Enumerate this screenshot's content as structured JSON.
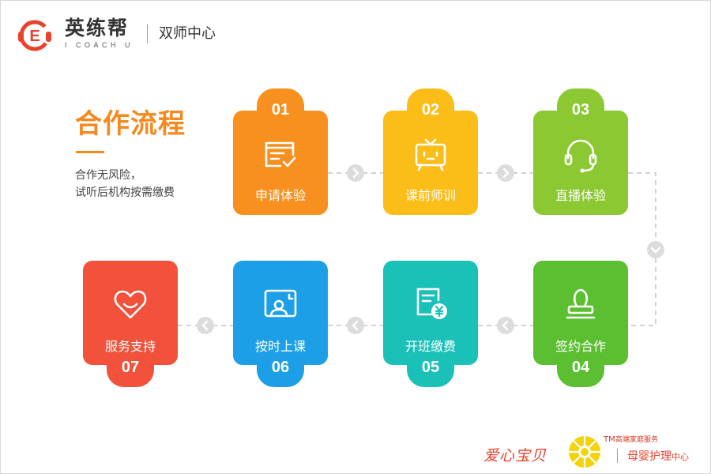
{
  "header": {
    "brand_name": "英练帮",
    "brand_sub": "I COACH U",
    "section_title": "双师中心"
  },
  "intro": {
    "title": "合作流程",
    "desc_line1": "合作无风险，",
    "desc_line2": "试听后机构按需缴费"
  },
  "steps": [
    {
      "num": "01",
      "label": "申请体验",
      "icon": "form-check-icon",
      "color": "#f7901e"
    },
    {
      "num": "02",
      "label": "课前师训",
      "icon": "tv-icon",
      "color": "#fbbd17"
    },
    {
      "num": "03",
      "label": "直播体验",
      "icon": "headset-icon",
      "color": "#8cc832"
    },
    {
      "num": "04",
      "label": "签约合作",
      "icon": "stamp-icon",
      "color": "#5bbf31"
    },
    {
      "num": "05",
      "label": "开班缴费",
      "icon": "bill-yuan-icon",
      "color": "#1ac1b9"
    },
    {
      "num": "06",
      "label": "按时上课",
      "icon": "teacher-screen-icon",
      "color": "#1c9fe6"
    },
    {
      "num": "07",
      "label": "服务支持",
      "icon": "heart-smile-icon",
      "color": "#f2513b"
    }
  ],
  "footer": {
    "brand": "爱心宝贝",
    "tm": "TM",
    "sub": "高端家庭服务",
    "right_main": "母婴护理",
    "right_small": "中心"
  }
}
